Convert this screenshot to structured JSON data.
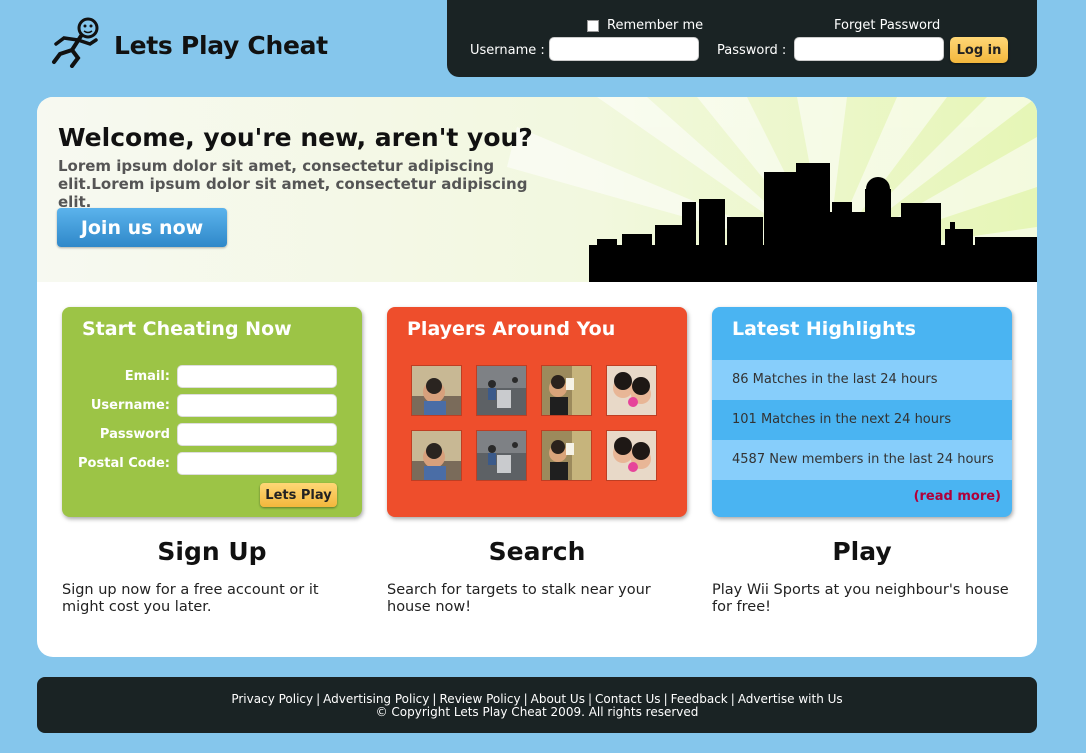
{
  "header": {
    "logo_text": "Lets Play Cheat"
  },
  "login": {
    "remember_label": "Remember me",
    "forget_label": "Forget Password",
    "username_label": "Username :",
    "password_label": "Password :",
    "username_value": "",
    "password_value": "",
    "login_button": "Log in"
  },
  "hero": {
    "title": "Welcome, you're new, aren't you?",
    "text": "Lorem ipsum dolor sit amet, consectetur adipiscing elit.Lorem ipsum dolor sit amet, consectetur adipiscing elit.",
    "join_button": "Join us now"
  },
  "signup_box": {
    "title": "Start Cheating Now",
    "fields": [
      {
        "label": "Email:",
        "value": ""
      },
      {
        "label": "Username:",
        "value": ""
      },
      {
        "label": "Password",
        "value": ""
      },
      {
        "label": "Postal Code:",
        "value": ""
      }
    ],
    "button": "Lets Play"
  },
  "players_box": {
    "title": "Players Around You",
    "thumbnails": [
      "player-photo-1",
      "player-photo-2",
      "player-photo-3",
      "player-photo-4",
      "player-photo-1",
      "player-photo-2",
      "player-photo-3",
      "player-photo-4"
    ]
  },
  "highlights_box": {
    "title": "Latest Highlights",
    "items": [
      "86 Matches in the last 24 hours",
      "101 Matches in the next 24 hours",
      "4587 New members in the last 24 hours"
    ],
    "read_more": "(read more)"
  },
  "columns": [
    {
      "title": "Sign Up",
      "desc": "Sign up now for a free account or it might cost you later."
    },
    {
      "title": "Search",
      "desc": "Search for targets to stalk near your house now!"
    },
    {
      "title": "Play",
      "desc": "Play Wii Sports at you neighbour's house for free!"
    }
  ],
  "footer": {
    "links": [
      "Privacy Policy",
      "Advertising Policy",
      "Review Policy",
      "About Us",
      "Contact Us",
      "Feedback",
      "Advertise with Us"
    ],
    "copyright": "© Copyright Lets Play Cheat 2009. All rights reserved"
  },
  "colors": {
    "background": "#85c6ec",
    "dark_panel": "#1a2324",
    "green_box": "#9cc446",
    "red_box": "#ee4e2c",
    "blue_box": "#4ab4f2",
    "button_yellow": "#f3b73c",
    "join_blue": "#2f88c9",
    "read_more": "#b0003a"
  }
}
